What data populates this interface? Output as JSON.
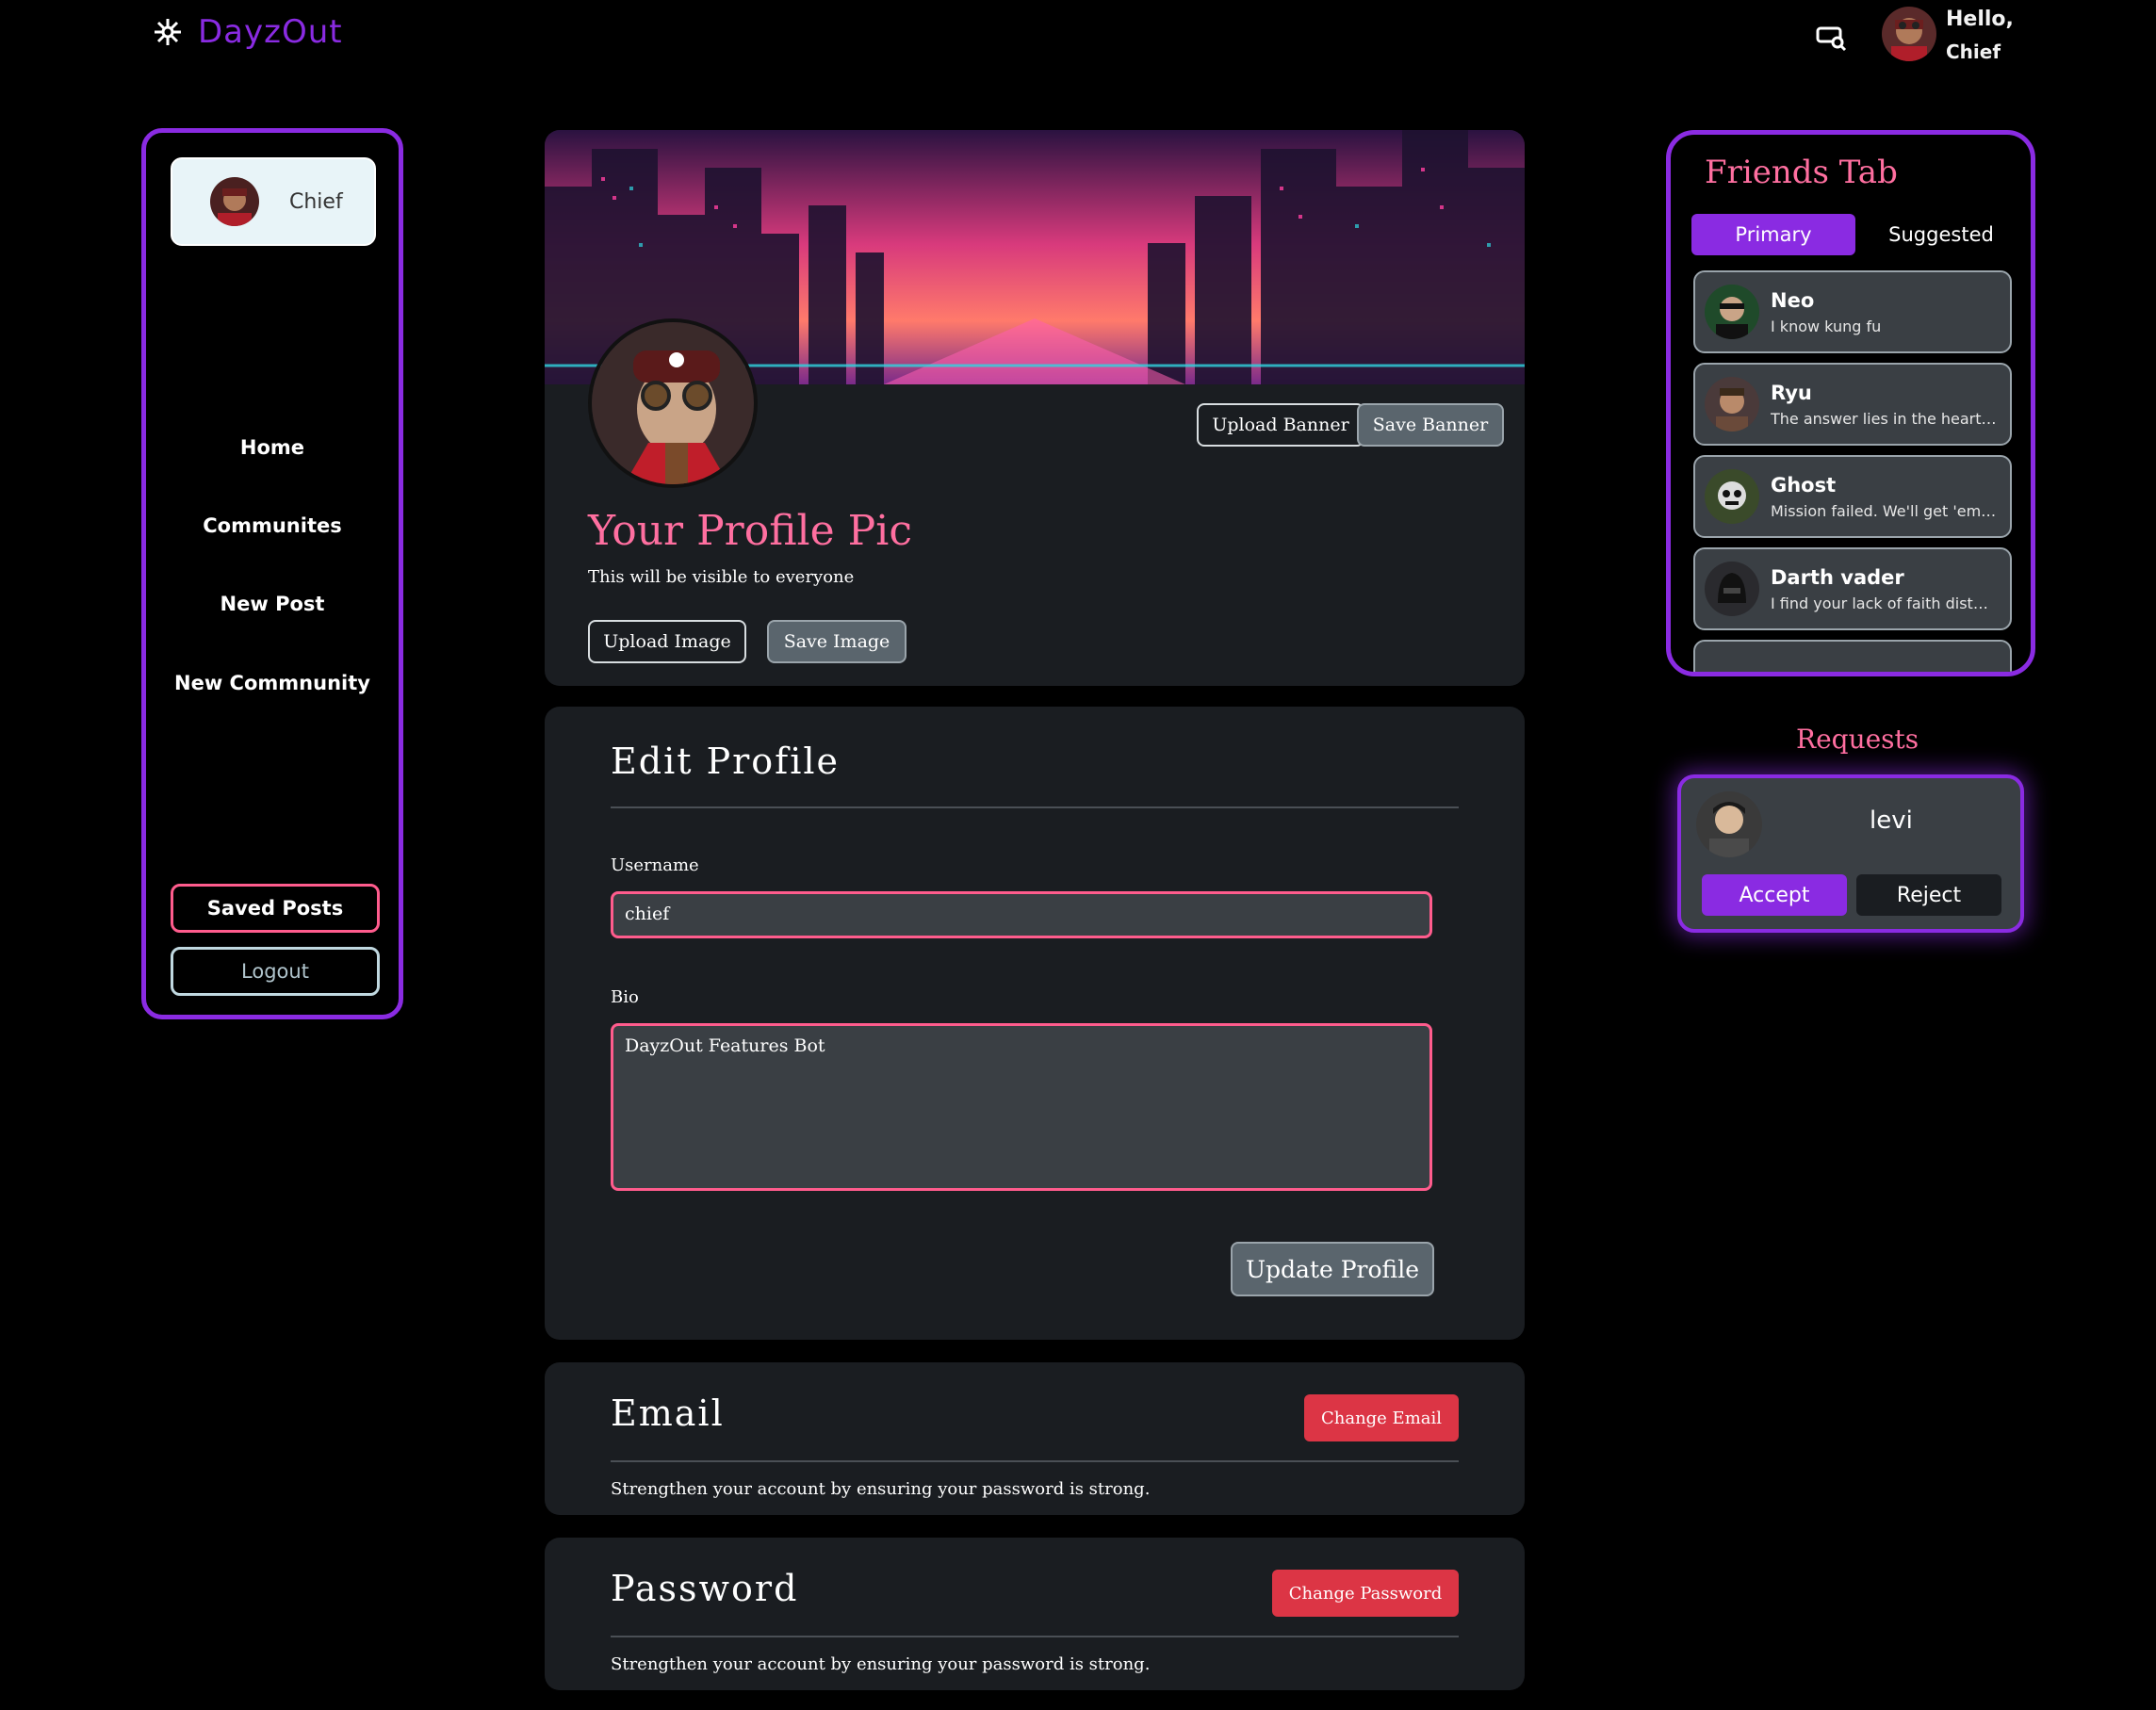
{
  "header": {
    "brand": "DayzOut",
    "greeting": "Hello,",
    "user": "Chief",
    "icons": {
      "logo": "snowflake-icon",
      "chat": "chat-search-icon"
    }
  },
  "sidebar": {
    "user_name": "Chief",
    "nav": [
      "Home",
      "Communites",
      "New Post",
      "New Commnunity"
    ],
    "saved_posts": "Saved Posts",
    "logout": "Logout"
  },
  "profile": {
    "upload_banner": "Upload Banner",
    "save_banner": "Save Banner",
    "title": "Your Profile Pic",
    "subtitle": "This will be visible to everyone",
    "upload_image": "Upload Image",
    "save_image": "Save Image"
  },
  "edit": {
    "title": "Edit Profile",
    "username_label": "Username",
    "username_value": "chief",
    "bio_label": "Bio",
    "bio_value": "DayzOut Features Bot",
    "update_button": "Update Profile"
  },
  "email": {
    "title": "Email",
    "button": "Change Email",
    "hint": "Strengthen your account by ensuring your password is strong."
  },
  "password": {
    "title": "Password",
    "button": "Change Password",
    "hint": "Strengthen your account by ensuring your password is strong."
  },
  "friends": {
    "title": "Friends Tab",
    "tabs": [
      "Primary",
      "Suggested"
    ],
    "list": [
      {
        "name": "Neo",
        "message": "I know kung fu"
      },
      {
        "name": "Ryu",
        "message": "The answer lies in the heart of ..."
      },
      {
        "name": "Ghost",
        "message": "Mission failed. We'll get 'em ne..."
      },
      {
        "name": "Darth vader",
        "message": "I find your lack of faith disturbi..."
      }
    ]
  },
  "requests": {
    "title": "Requests",
    "name": "levi",
    "accept": "Accept",
    "reject": "Reject"
  },
  "colors": {
    "accent": "#8a2be2",
    "pink": "#ff6fa0",
    "danger": "#dc3545",
    "card": "#1a1d21"
  }
}
